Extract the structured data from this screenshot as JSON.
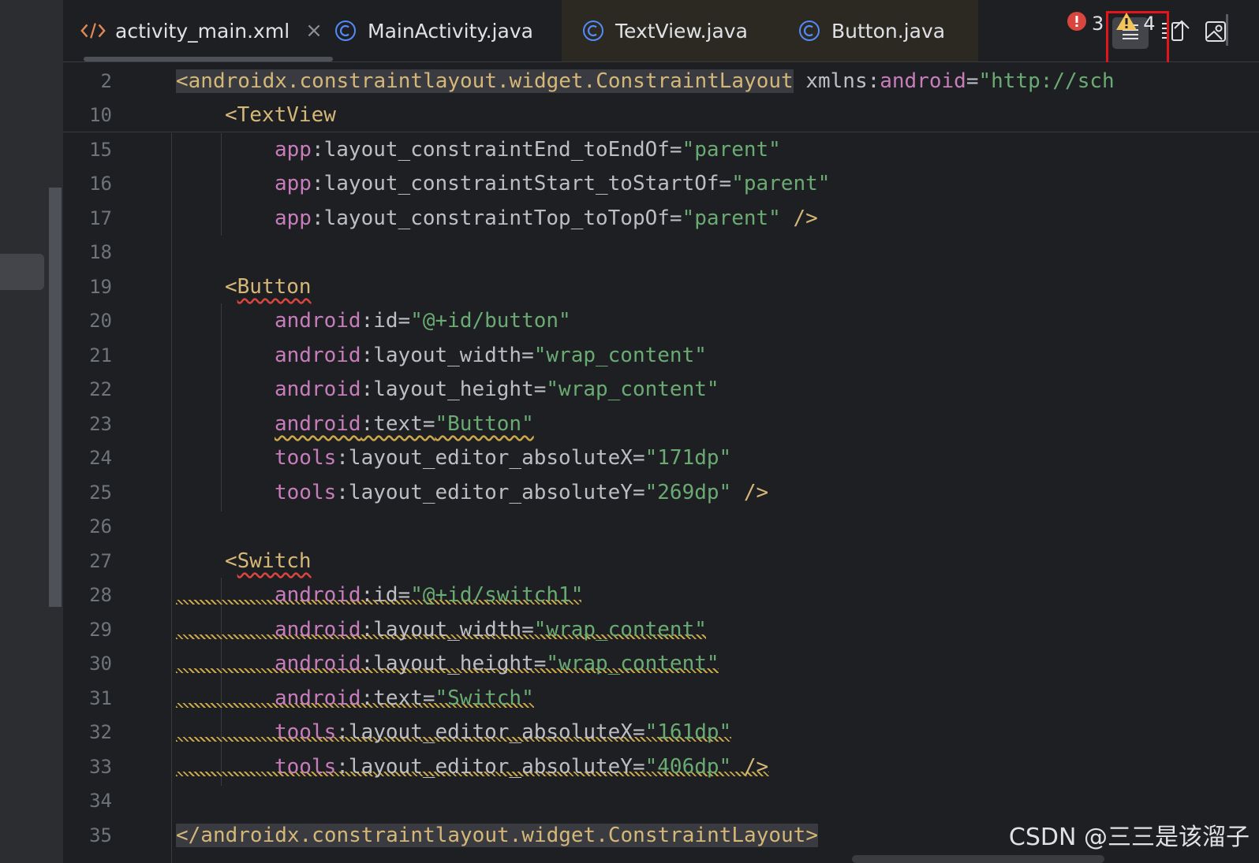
{
  "tabs": [
    {
      "label": "activity_main.xml",
      "icon": "xml-code-icon",
      "active": true
    },
    {
      "label": "MainActivity.java",
      "icon": "class-icon"
    },
    {
      "label": "TextView.java",
      "icon": "class-icon"
    },
    {
      "label": "Button.java",
      "icon": "class-icon"
    }
  ],
  "tab_close_glyph": "×",
  "view_modes": [
    "code-view-icon",
    "split-view-icon",
    "design-view-icon"
  ],
  "inspections": {
    "errors": "3",
    "warnings": "4"
  },
  "editor": {
    "lines": [
      {
        "n": "2"
      },
      {
        "n": "10"
      },
      {
        "n": "15"
      },
      {
        "n": "16"
      },
      {
        "n": "17"
      },
      {
        "n": "18"
      },
      {
        "n": "19"
      },
      {
        "n": "20"
      },
      {
        "n": "21"
      },
      {
        "n": "22"
      },
      {
        "n": "23"
      },
      {
        "n": "24"
      },
      {
        "n": "25"
      },
      {
        "n": "26"
      },
      {
        "n": "27"
      },
      {
        "n": "28"
      },
      {
        "n": "29"
      },
      {
        "n": "30"
      },
      {
        "n": "31"
      },
      {
        "n": "32"
      },
      {
        "n": "33"
      },
      {
        "n": "34"
      },
      {
        "n": "35"
      }
    ],
    "code": {
      "l2_tag": "<androidx.constraintlayout.widget.ConstraintLayout",
      "l2_xmlns": " xmlns:",
      "l2_android": "android",
      "l2_eq": "=",
      "l2_str": "\"http://sch",
      "l10": "<TextView",
      "l15_p": "app",
      "l15_n": ":layout_constraintEnd_toEndOf=",
      "l15_v": "\"parent\"",
      "l16_p": "app",
      "l16_n": ":layout_constraintStart_toStartOf=",
      "l16_v": "\"parent\"",
      "l17_p": "app",
      "l17_n": ":layout_constraintTop_toTopOf=",
      "l17_v": "\"parent\"",
      "l17_end": " />",
      "l19_lt": "<",
      "l19_tag": "Button",
      "l20_p": "android",
      "l20_n": ":id=",
      "l20_v": "\"@+id/button\"",
      "l21_p": "android",
      "l21_n": ":layout_width=",
      "l21_v": "\"wrap_content\"",
      "l22_p": "android",
      "l22_n": ":layout_height=",
      "l22_v": "\"wrap_content\"",
      "l23_p": "android",
      "l23_n": ":text=",
      "l23_v": "\"Button\"",
      "l24_p": "tools",
      "l24_n": ":layout_editor_absoluteX=",
      "l24_v": "\"171dp\"",
      "l25_p": "tools",
      "l25_n": ":layout_editor_absoluteY=",
      "l25_v": "\"269dp\"",
      "l25_end": " />",
      "l27_lt": "<",
      "l27_tag": "Switch",
      "l28_p": "android",
      "l28_n": ":id=",
      "l28_v": "\"@+id/switch1\"",
      "l29_p": "android",
      "l29_n": ":layout_width=",
      "l29_v": "\"wrap_content\"",
      "l30_p": "android",
      "l30_n": ":layout_height=",
      "l30_v": "\"wrap_content\"",
      "l31_p": "android",
      "l31_n": ":text=",
      "l31_v": "\"Switch\"",
      "l32_p": "tools",
      "l32_n": ":layout_editor_absoluteX=",
      "l32_v": "\"161dp\"",
      "l33_p": "tools",
      "l33_n": ":layout_editor_absoluteY=",
      "l33_v": "\"406dp\"",
      "l33_end": " />",
      "l35": "</androidx.constraintlayout.widget.ConstraintLayout>"
    }
  },
  "watermark": "CSDN @三三是该溜子",
  "colors": {
    "accent_red_box": "#e3151b",
    "error": "#d9463f",
    "warning": "#f2c55c"
  }
}
